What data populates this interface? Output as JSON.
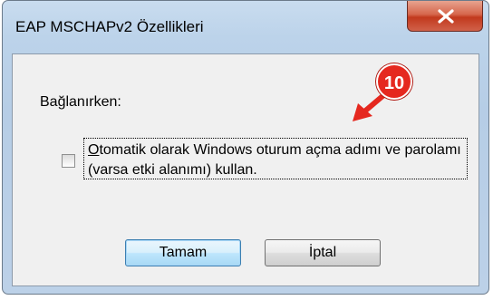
{
  "window": {
    "title": "EAP MSCHAPv2 Özellikleri",
    "close_glyph": "X"
  },
  "dialog": {
    "connecting_label": "Bağlanırken:",
    "option": {
      "checked": false,
      "mnemonic": "O",
      "text_rest": "tomatik olarak Windows oturum açma adımı ve parolamı (varsa etki alanımı) kullan."
    },
    "buttons": {
      "ok_label": "Tamam",
      "cancel_label": "İptal"
    }
  },
  "annotation": {
    "step_number": "10",
    "color": "#e5281f"
  }
}
